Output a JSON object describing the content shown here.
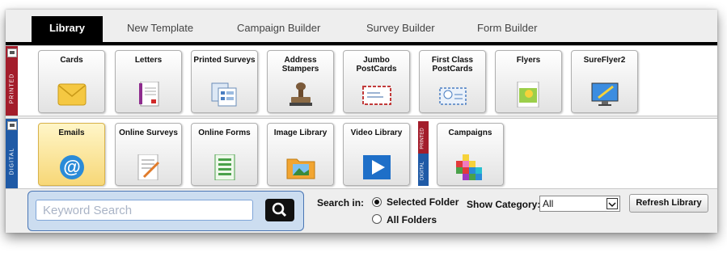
{
  "tabs": [
    {
      "label": "Library",
      "active": true
    },
    {
      "label": "New Template",
      "active": false
    },
    {
      "label": "Campaign Builder",
      "active": false
    },
    {
      "label": "Survey Builder",
      "active": false
    },
    {
      "label": "Form Builder",
      "active": false
    }
  ],
  "printed_section": {
    "side_label": "PRINTED",
    "items": [
      {
        "label": "Cards",
        "icon": "envelope-icon"
      },
      {
        "label": "Letters",
        "icon": "letter-icon"
      },
      {
        "label": "Printed Surveys",
        "icon": "printed-survey-icon"
      },
      {
        "label": "Address\nStampers",
        "icon": "stamper-icon"
      },
      {
        "label": "Jumbo\nPostCards",
        "icon": "jumbo-postcard-icon"
      },
      {
        "label": "First Class\nPostCards",
        "icon": "first-class-postcard-icon"
      },
      {
        "label": "Flyers",
        "icon": "flyer-icon"
      },
      {
        "label": "SureFlyer2",
        "icon": "sureflyer-monitor-icon"
      }
    ]
  },
  "digital_section": {
    "side_label": "DIGITAL",
    "items": [
      {
        "label": "Emails",
        "icon": "email-at-icon",
        "selected": true
      },
      {
        "label": "Online Surveys",
        "icon": "online-survey-icon"
      },
      {
        "label": "Online Forms",
        "icon": "online-form-icon"
      },
      {
        "label": "Image Library",
        "icon": "image-folder-icon"
      },
      {
        "label": "Video Library",
        "icon": "video-play-icon"
      }
    ],
    "divider": {
      "top_label": "PRINTED",
      "bottom_label": "DIGITAL"
    },
    "extra_items": [
      {
        "label": "Campaigns",
        "icon": "campaign-blocks-icon"
      }
    ]
  },
  "search": {
    "placeholder": "Keyword Search",
    "search_in_label": "Search in:",
    "options": [
      {
        "label": "Selected Folder",
        "checked": true
      },
      {
        "label": "All Folders",
        "checked": false
      }
    ],
    "category_label": "Show Category:",
    "category_value": "All",
    "refresh_label": "Refresh Library"
  },
  "colors": {
    "printed": "#a31d2b",
    "digital": "#1f5aa6",
    "tab_active": "#000000",
    "selected_card": "#f7d777"
  }
}
